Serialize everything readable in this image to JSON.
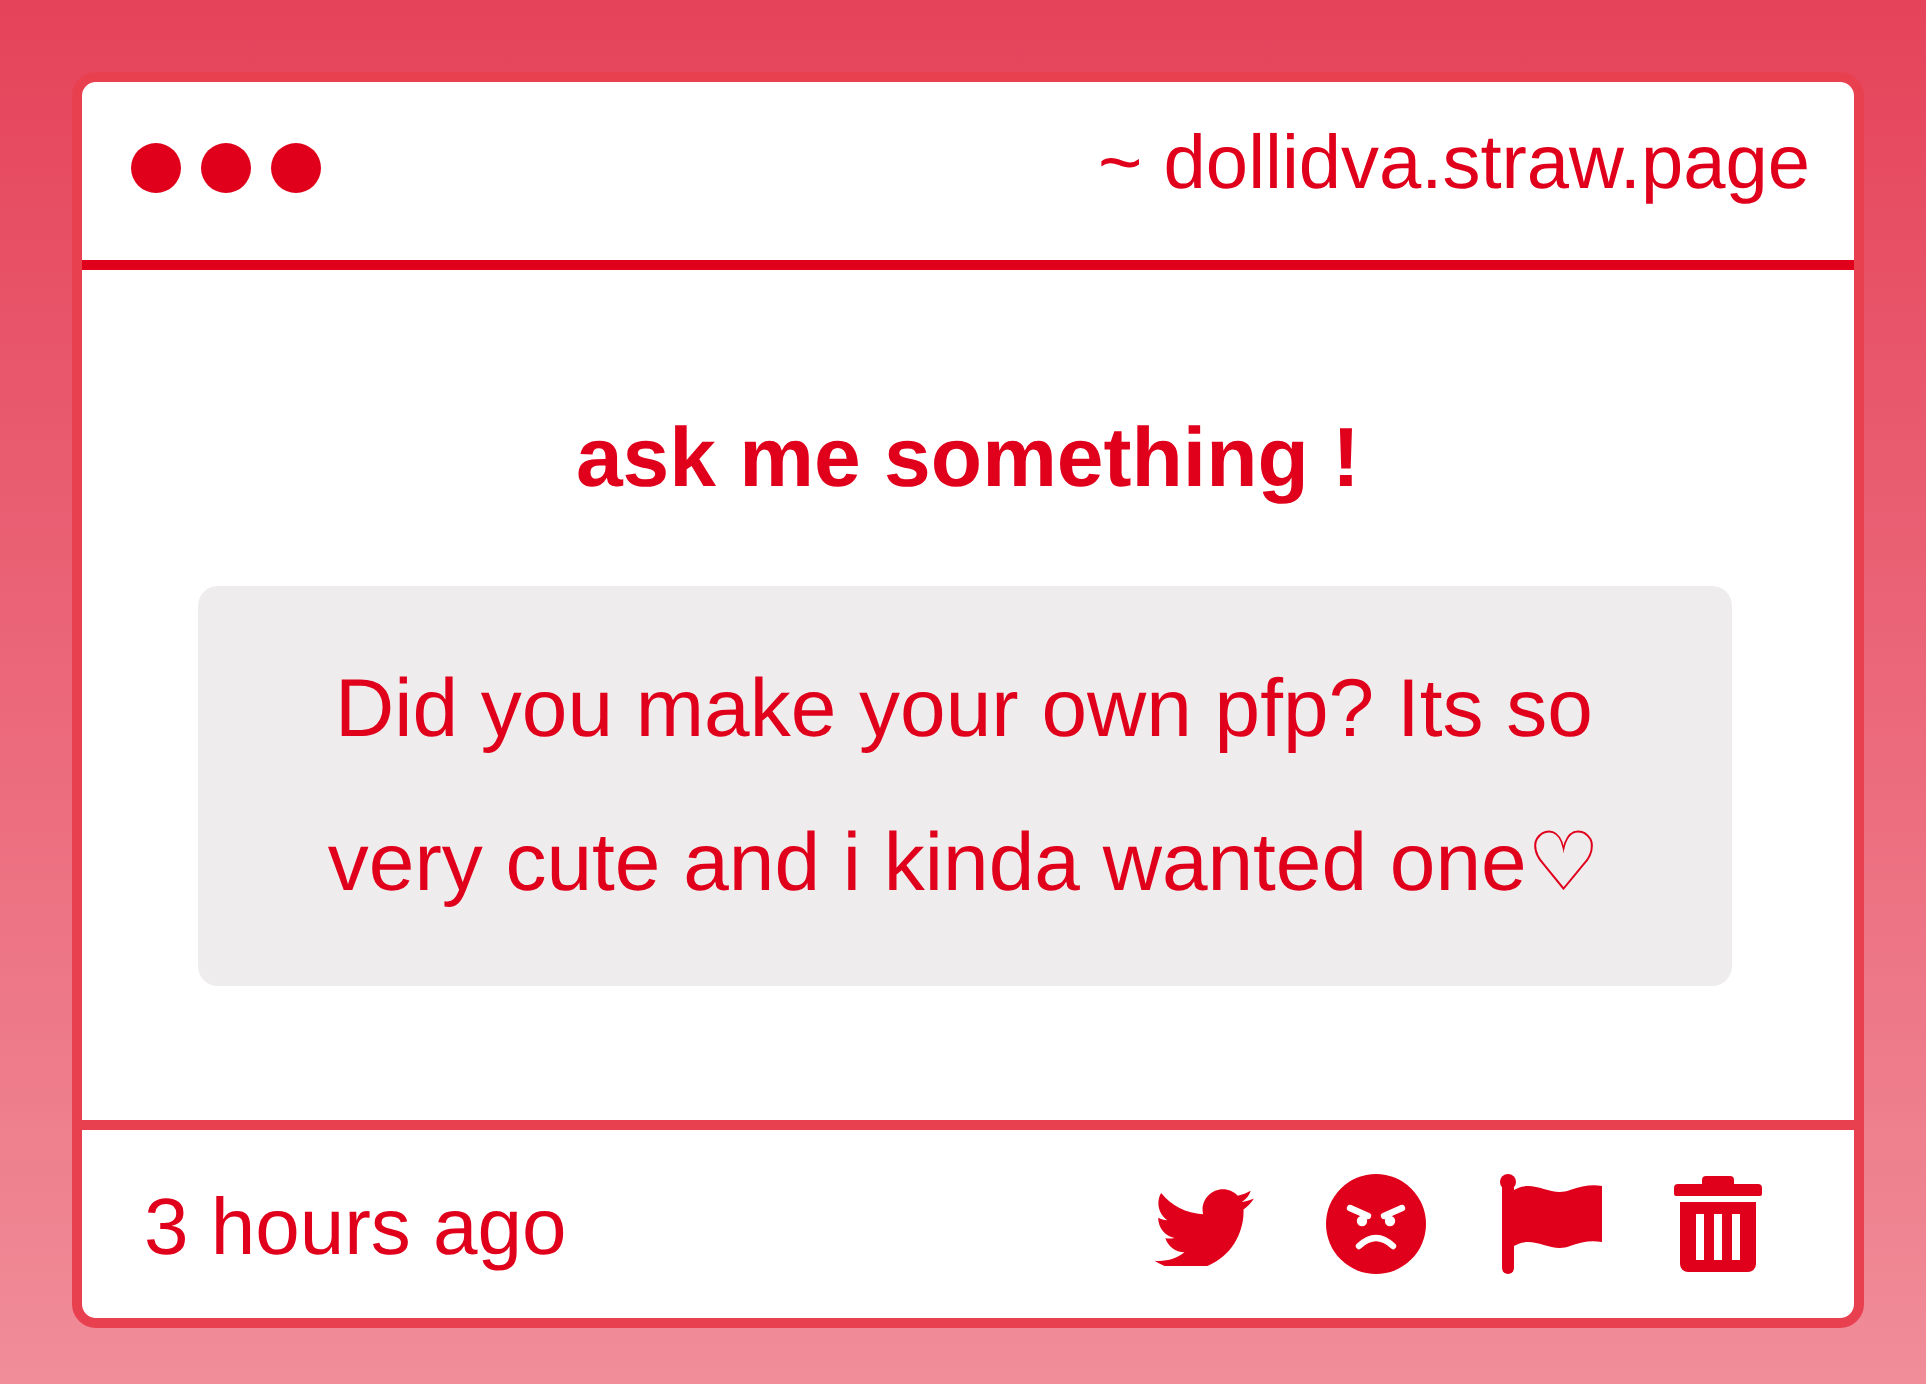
{
  "window": {
    "url": "~ dollidva.straw.page"
  },
  "heading": "ask me something !",
  "question": "Did you make your own pfp? Its so very cute and i kinda wanted one♡",
  "footer": {
    "time": "3 hours ago"
  }
}
